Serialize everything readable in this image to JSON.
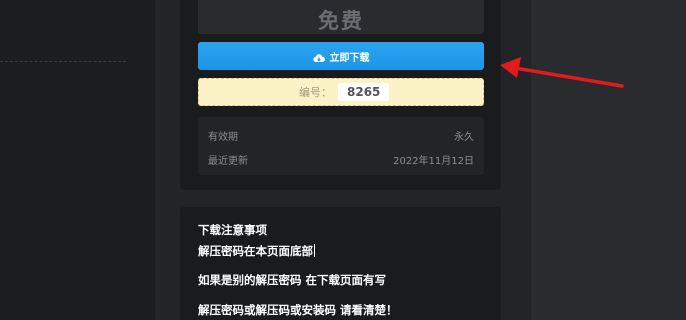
{
  "download_card": {
    "price": "免费",
    "download_button": {
      "label": "立即下载",
      "icon": "cloud-download-icon",
      "color": "#1f9ae9"
    },
    "code": {
      "label": "编号：",
      "value": "8265"
    },
    "meta": [
      {
        "label": "有效期",
        "value": "永久"
      },
      {
        "label": "最近更新",
        "value": "2022年11月12日"
      }
    ]
  },
  "notes": {
    "title": "下载注意事项",
    "lines": [
      "解压密码在本页面底部",
      "如果是别的解压密码 在下载页面有写",
      "解压密码或解压码或安装码 请看清楚！"
    ]
  },
  "annotation": {
    "arrow_color": "#e01c1c"
  }
}
